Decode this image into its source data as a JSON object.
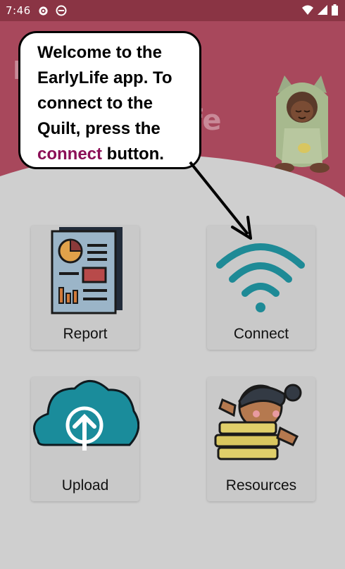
{
  "status_bar": {
    "time": "7:46"
  },
  "header": {
    "title_left": "E",
    "title_right": "fe"
  },
  "tiles": [
    {
      "label": "Report"
    },
    {
      "label": "Connect"
    },
    {
      "label": "Upload"
    },
    {
      "label": "Resources"
    }
  ],
  "callout": {
    "line1": "Welcome to the",
    "line2": "EarlyLife app. To",
    "line3": "connect to the",
    "line4": "Quilt, press the",
    "highlight": "connect",
    "tail": " button."
  },
  "colors": {
    "header": "#a8485c",
    "highlight": "#8b0f57",
    "wifi": "#1e8a96",
    "cloud": "#1a8c9b"
  },
  "icons": [
    "gear-icon",
    "no-disturb-icon",
    "wifi-status-icon",
    "signal-icon",
    "battery-icon",
    "report-icon",
    "wifi-icon",
    "upload-cloud-icon",
    "resources-books-icon"
  ]
}
